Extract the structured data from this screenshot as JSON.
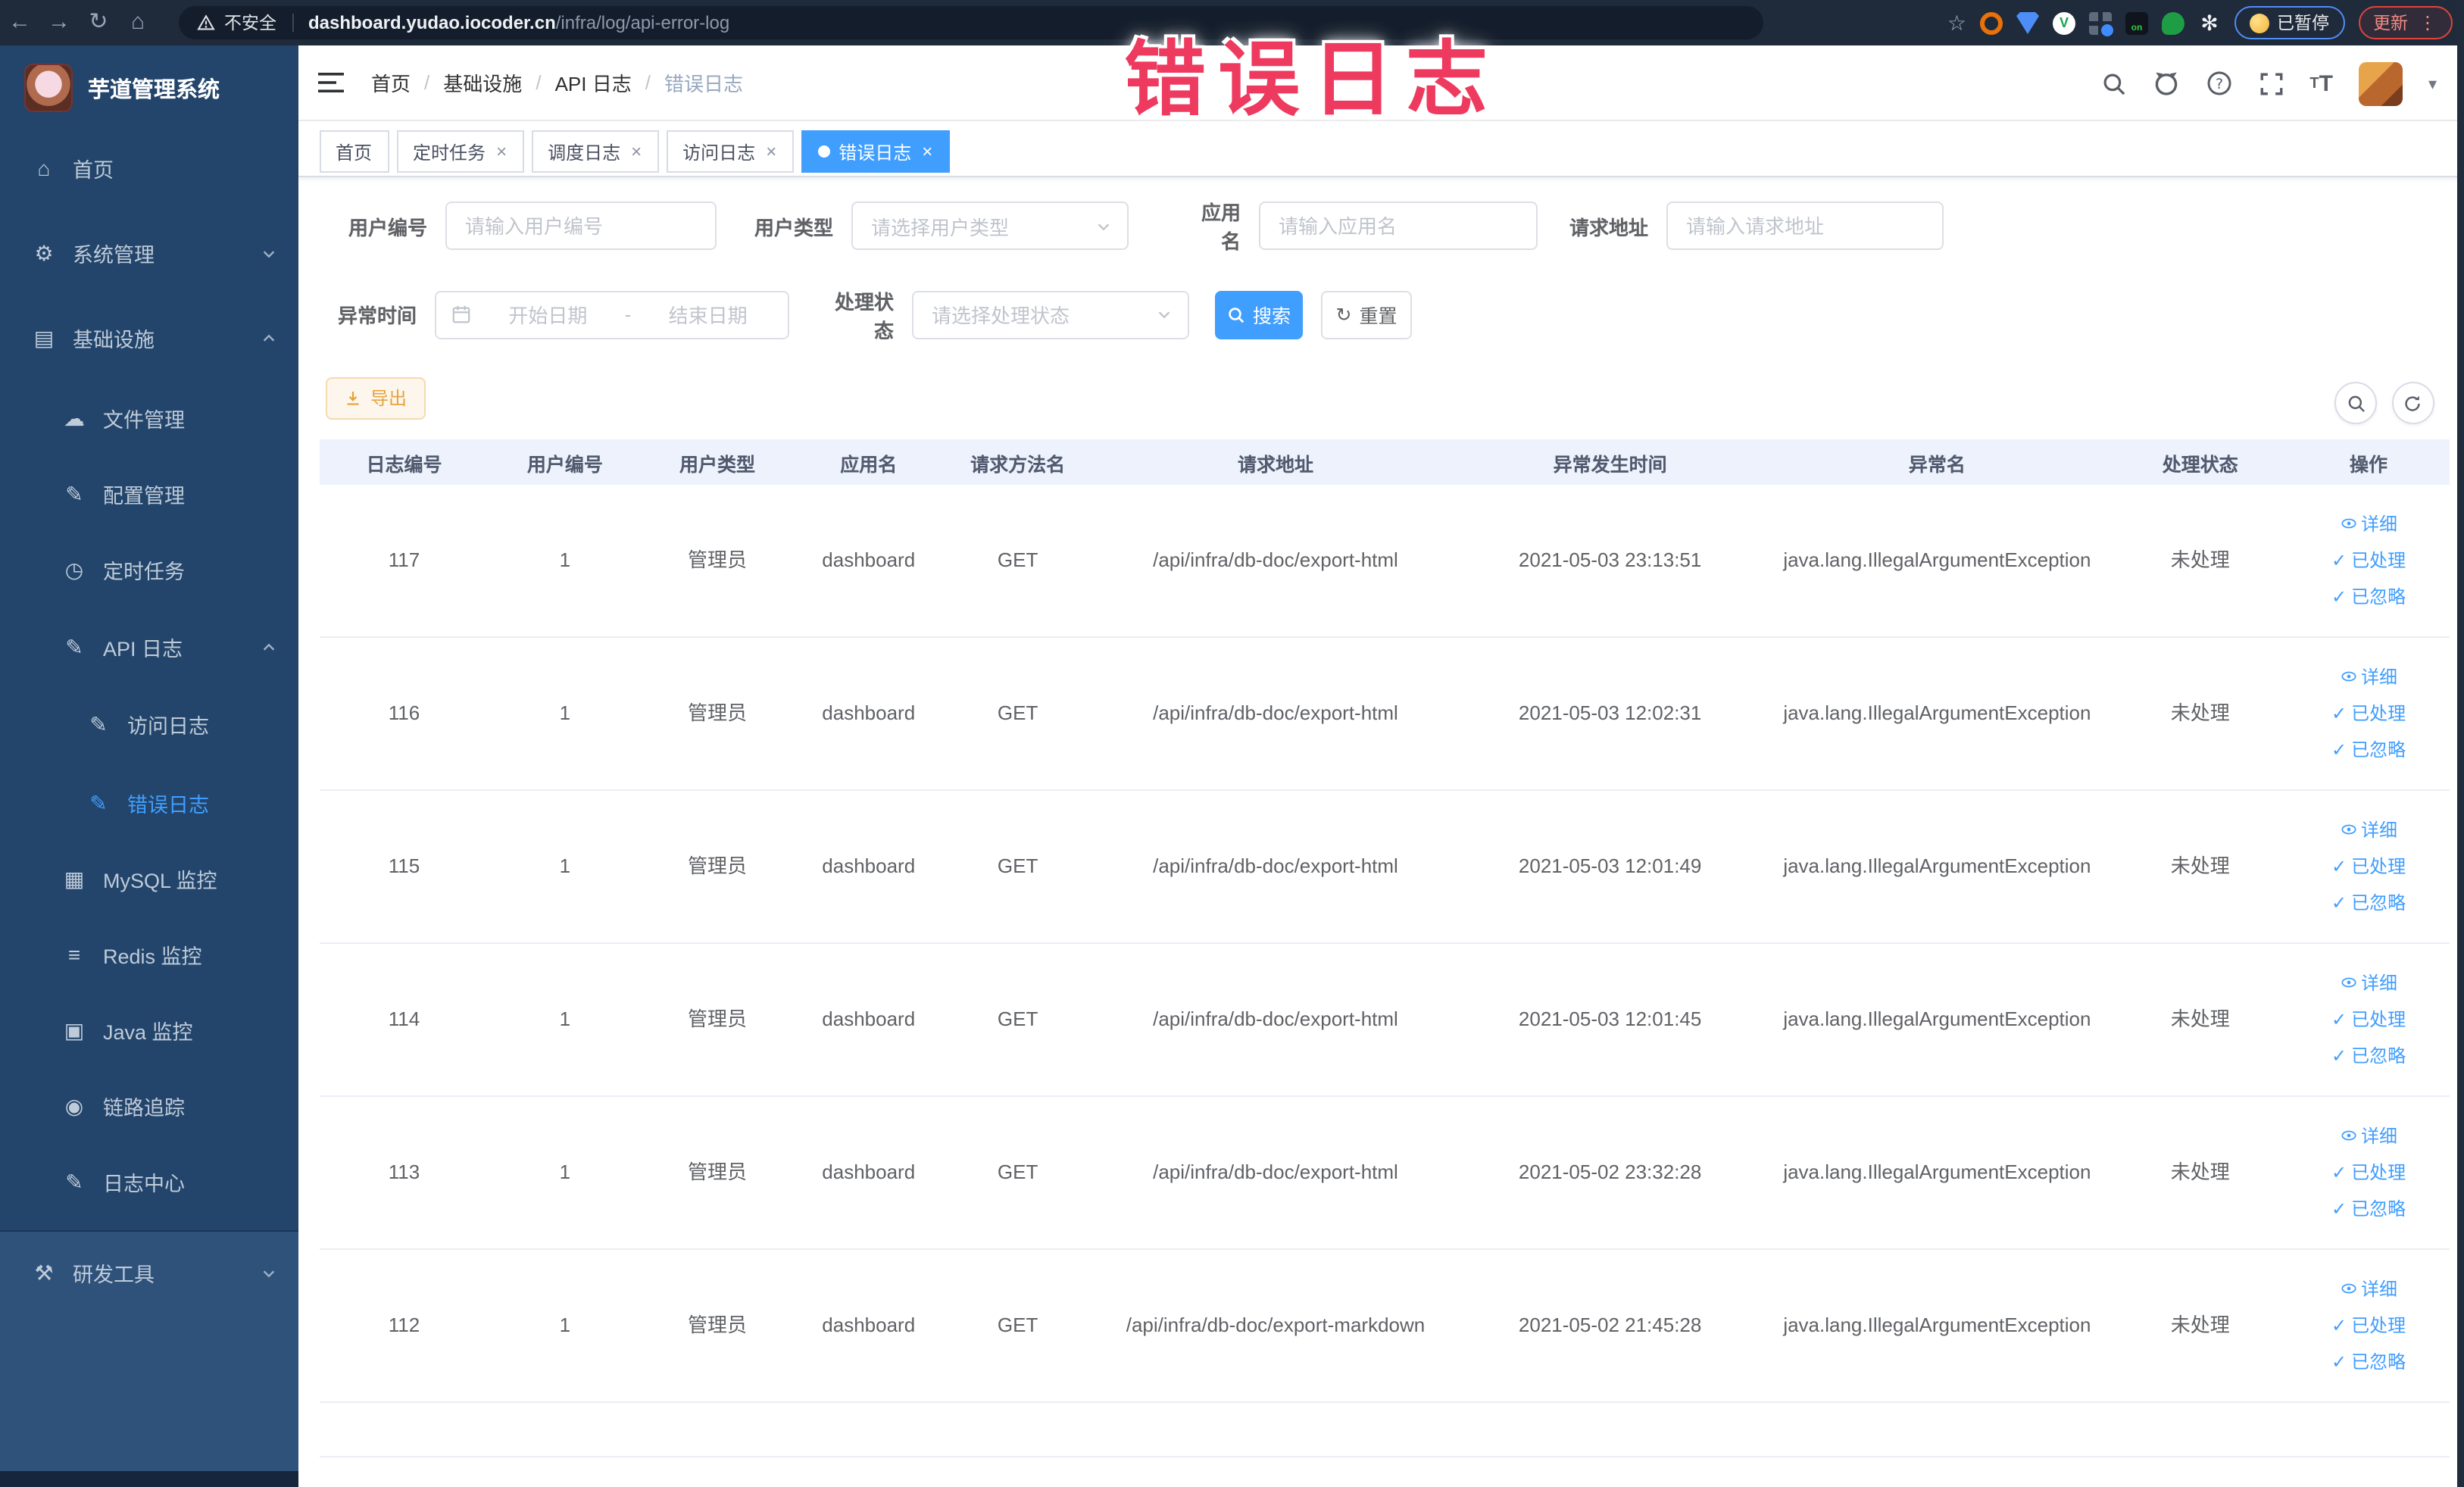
{
  "chrome": {
    "security_label": "不安全",
    "url_host": "dashboard.yudao.iocoder.cn",
    "url_path": "/infra/log/api-error-log",
    "paused_badge_label": "已暂停",
    "update_button_label": "更新",
    "on_badge_label": "on",
    "v_badge_label": "V"
  },
  "annotation": {
    "text": "错误日志"
  },
  "icons": {
    "back": "←",
    "forward": "→",
    "reload": "↻",
    "chrome_home": "⌂",
    "star": "☆",
    "puppet": "✻",
    "dots": "⋮",
    "caret_down": "▾",
    "check": "✓",
    "font_size": "T",
    "home": "⌂",
    "system": "⚙",
    "infra": "▤",
    "file": "☁",
    "config": "✎",
    "job": "◷",
    "apilog": "✎",
    "accesslog": "✎",
    "errorlog": "✎",
    "mysql": "▦",
    "redis": "≡",
    "java": "▣",
    "trace": "◉",
    "logcenter": "✎",
    "devtools": "⚒"
  },
  "sidebar": {
    "logo_title": "芋道管理系统",
    "items": [
      {
        "label": "首页"
      },
      {
        "label": "系统管理"
      },
      {
        "label": "基础设施"
      },
      {
        "label": "文件管理"
      },
      {
        "label": "配置管理"
      },
      {
        "label": "定时任务"
      },
      {
        "label": "API 日志"
      },
      {
        "label": "访问日志"
      },
      {
        "label": "错误日志"
      },
      {
        "label": "MySQL 监控"
      },
      {
        "label": "Redis 监控"
      },
      {
        "label": "Java 监控"
      },
      {
        "label": "链路追踪"
      },
      {
        "label": "日志中心"
      },
      {
        "label": "研发工具"
      }
    ]
  },
  "breadcrumb": {
    "items": [
      "首页",
      "基础设施",
      "API 日志",
      "错误日志"
    ]
  },
  "tabs": [
    {
      "label": "首页"
    },
    {
      "label": "定时任务"
    },
    {
      "label": "调度日志"
    },
    {
      "label": "访问日志"
    },
    {
      "label": "错误日志"
    }
  ],
  "filters": {
    "user_id_label": "用户编号",
    "user_id_placeholder": "请输入用户编号",
    "user_type_label": "用户类型",
    "user_type_placeholder": "请选择用户类型",
    "app_name_label": "应用名",
    "app_name_placeholder": "请输入应用名",
    "request_url_label": "请求地址",
    "request_url_placeholder": "请输入请求地址",
    "exception_time_label": "异常时间",
    "date_start_placeholder": "开始日期",
    "date_separator": "-",
    "date_end_placeholder": "结束日期",
    "process_status_label": "处理状态",
    "process_status_placeholder": "请选择处理状态",
    "search_button": "搜索",
    "reset_button": "重置"
  },
  "toolbar": {
    "export_button": "导出"
  },
  "table": {
    "columns": [
      "日志编号",
      "用户编号",
      "用户类型",
      "应用名",
      "请求方法名",
      "请求地址",
      "异常发生时间",
      "异常名",
      "处理状态",
      "操作"
    ],
    "action_labels": {
      "detail": "详细",
      "processed": "已处理",
      "ignored": "已忽略"
    },
    "rows": [
      {
        "id": "117",
        "user_id": "1",
        "user_type": "管理员",
        "app": "dashboard",
        "method": "GET",
        "url": "/api/infra/db-doc/export-html",
        "time": "2021-05-03 23:13:51",
        "exception": "java.lang.IllegalArgumentException",
        "status": "未处理"
      },
      {
        "id": "116",
        "user_id": "1",
        "user_type": "管理员",
        "app": "dashboard",
        "method": "GET",
        "url": "/api/infra/db-doc/export-html",
        "time": "2021-05-03 12:02:31",
        "exception": "java.lang.IllegalArgumentException",
        "status": "未处理"
      },
      {
        "id": "115",
        "user_id": "1",
        "user_type": "管理员",
        "app": "dashboard",
        "method": "GET",
        "url": "/api/infra/db-doc/export-html",
        "time": "2021-05-03 12:01:49",
        "exception": "java.lang.IllegalArgumentException",
        "status": "未处理"
      },
      {
        "id": "114",
        "user_id": "1",
        "user_type": "管理员",
        "app": "dashboard",
        "method": "GET",
        "url": "/api/infra/db-doc/export-html",
        "time": "2021-05-03 12:01:45",
        "exception": "java.lang.IllegalArgumentException",
        "status": "未处理"
      },
      {
        "id": "113",
        "user_id": "1",
        "user_type": "管理员",
        "app": "dashboard",
        "method": "GET",
        "url": "/api/infra/db-doc/export-html",
        "time": "2021-05-02 23:32:28",
        "exception": "java.lang.IllegalArgumentException",
        "status": "未处理"
      },
      {
        "id": "112",
        "user_id": "1",
        "user_type": "管理员",
        "app": "dashboard",
        "method": "GET",
        "url": "/api/infra/db-doc/export-markdown",
        "time": "2021-05-02 21:45:28",
        "exception": "java.lang.IllegalArgumentException",
        "status": "未处理"
      }
    ]
  },
  "colors": {
    "accent": "#409eff",
    "annotation": "#ee3a5f",
    "warning": "#e6a23c",
    "sidebar_bg": "#23456b",
    "sidebar_bg_light": "#2f527b",
    "chrome_bg": "#1f2a3a",
    "table_header_bg": "#edf2fc"
  }
}
